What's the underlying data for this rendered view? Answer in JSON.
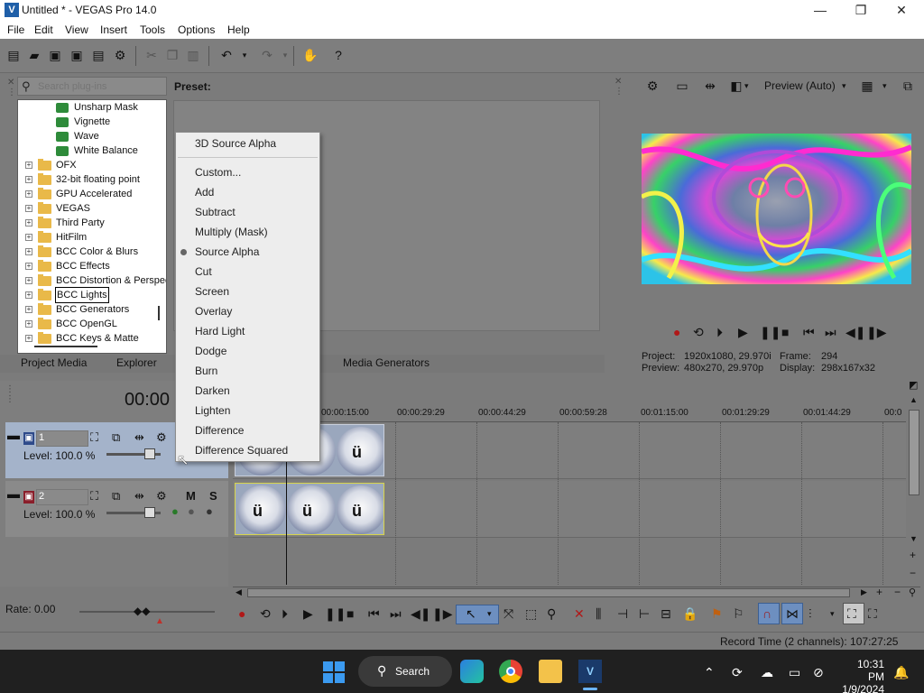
{
  "window": {
    "title": "Untitled * - VEGAS Pro 14.0",
    "controls": [
      "—",
      "❐",
      "✕"
    ]
  },
  "menu": [
    "File",
    "Edit",
    "View",
    "Insert",
    "Tools",
    "Options",
    "Help"
  ],
  "plugin_browser": {
    "search_placeholder": "Search plug-ins",
    "preset_label": "Preset:",
    "fx_items": [
      "Unsharp Mask",
      "Vignette",
      "Wave",
      "White Balance"
    ],
    "folders": [
      "OFX",
      "32-bit floating point",
      "GPU Accelerated",
      "VEGAS",
      "Third Party",
      "HitFilm",
      "BCC Color & Blurs",
      "BCC Effects",
      "BCC Distortion & Perspective",
      "BCC Lights",
      "BCC Generators",
      "BCC OpenGL",
      "BCC Keys & Matte"
    ],
    "selected": "BCC Lights"
  },
  "tabs": [
    "Project Media",
    "Explorer",
    "Media Generators"
  ],
  "dropdown": {
    "items": [
      "3D Source Alpha",
      "Custom...",
      "Add",
      "Subtract",
      "Multiply (Mask)",
      "Source Alpha",
      "Cut",
      "Screen",
      "Overlay",
      "Hard Light",
      "Dodge",
      "Burn",
      "Darken",
      "Lighten",
      "Difference",
      "Difference Squared"
    ],
    "checked": "Source Alpha"
  },
  "preview": {
    "mode_label": "Preview (Auto)",
    "project_label": "Project:",
    "project_value": "1920x1080, 29.970i",
    "preview_label": "Preview:",
    "preview_value": "480x270, 29.970p",
    "frame_label": "Frame:",
    "frame_value": "294",
    "display_label": "Display:",
    "display_value": "298x167x32"
  },
  "timeline": {
    "timecode": "00:00",
    "ruler": [
      "00:00:15:00",
      "00:00:29:29",
      "00:00:44:29",
      "00:00:59:28",
      "00:01:15:00",
      "00:01:29:29",
      "00:01:44:29",
      "00:0"
    ],
    "tracks": [
      {
        "number": "1",
        "level": "Level: 100.0 %"
      },
      {
        "number": "2",
        "level": "Level: 100.0 %",
        "mute": "M",
        "solo": "S"
      }
    ],
    "rate": "Rate: 0.00",
    "status": "Record Time (2 channels): 107:27:25"
  },
  "taskbar": {
    "search_label": "Search",
    "time": "10:31 PM",
    "date": "1/9/2024"
  },
  "colors": {
    "panel_gray": "#7b7b7b",
    "track1_selected": "#a4b3ca",
    "taskbar": "#202020"
  }
}
